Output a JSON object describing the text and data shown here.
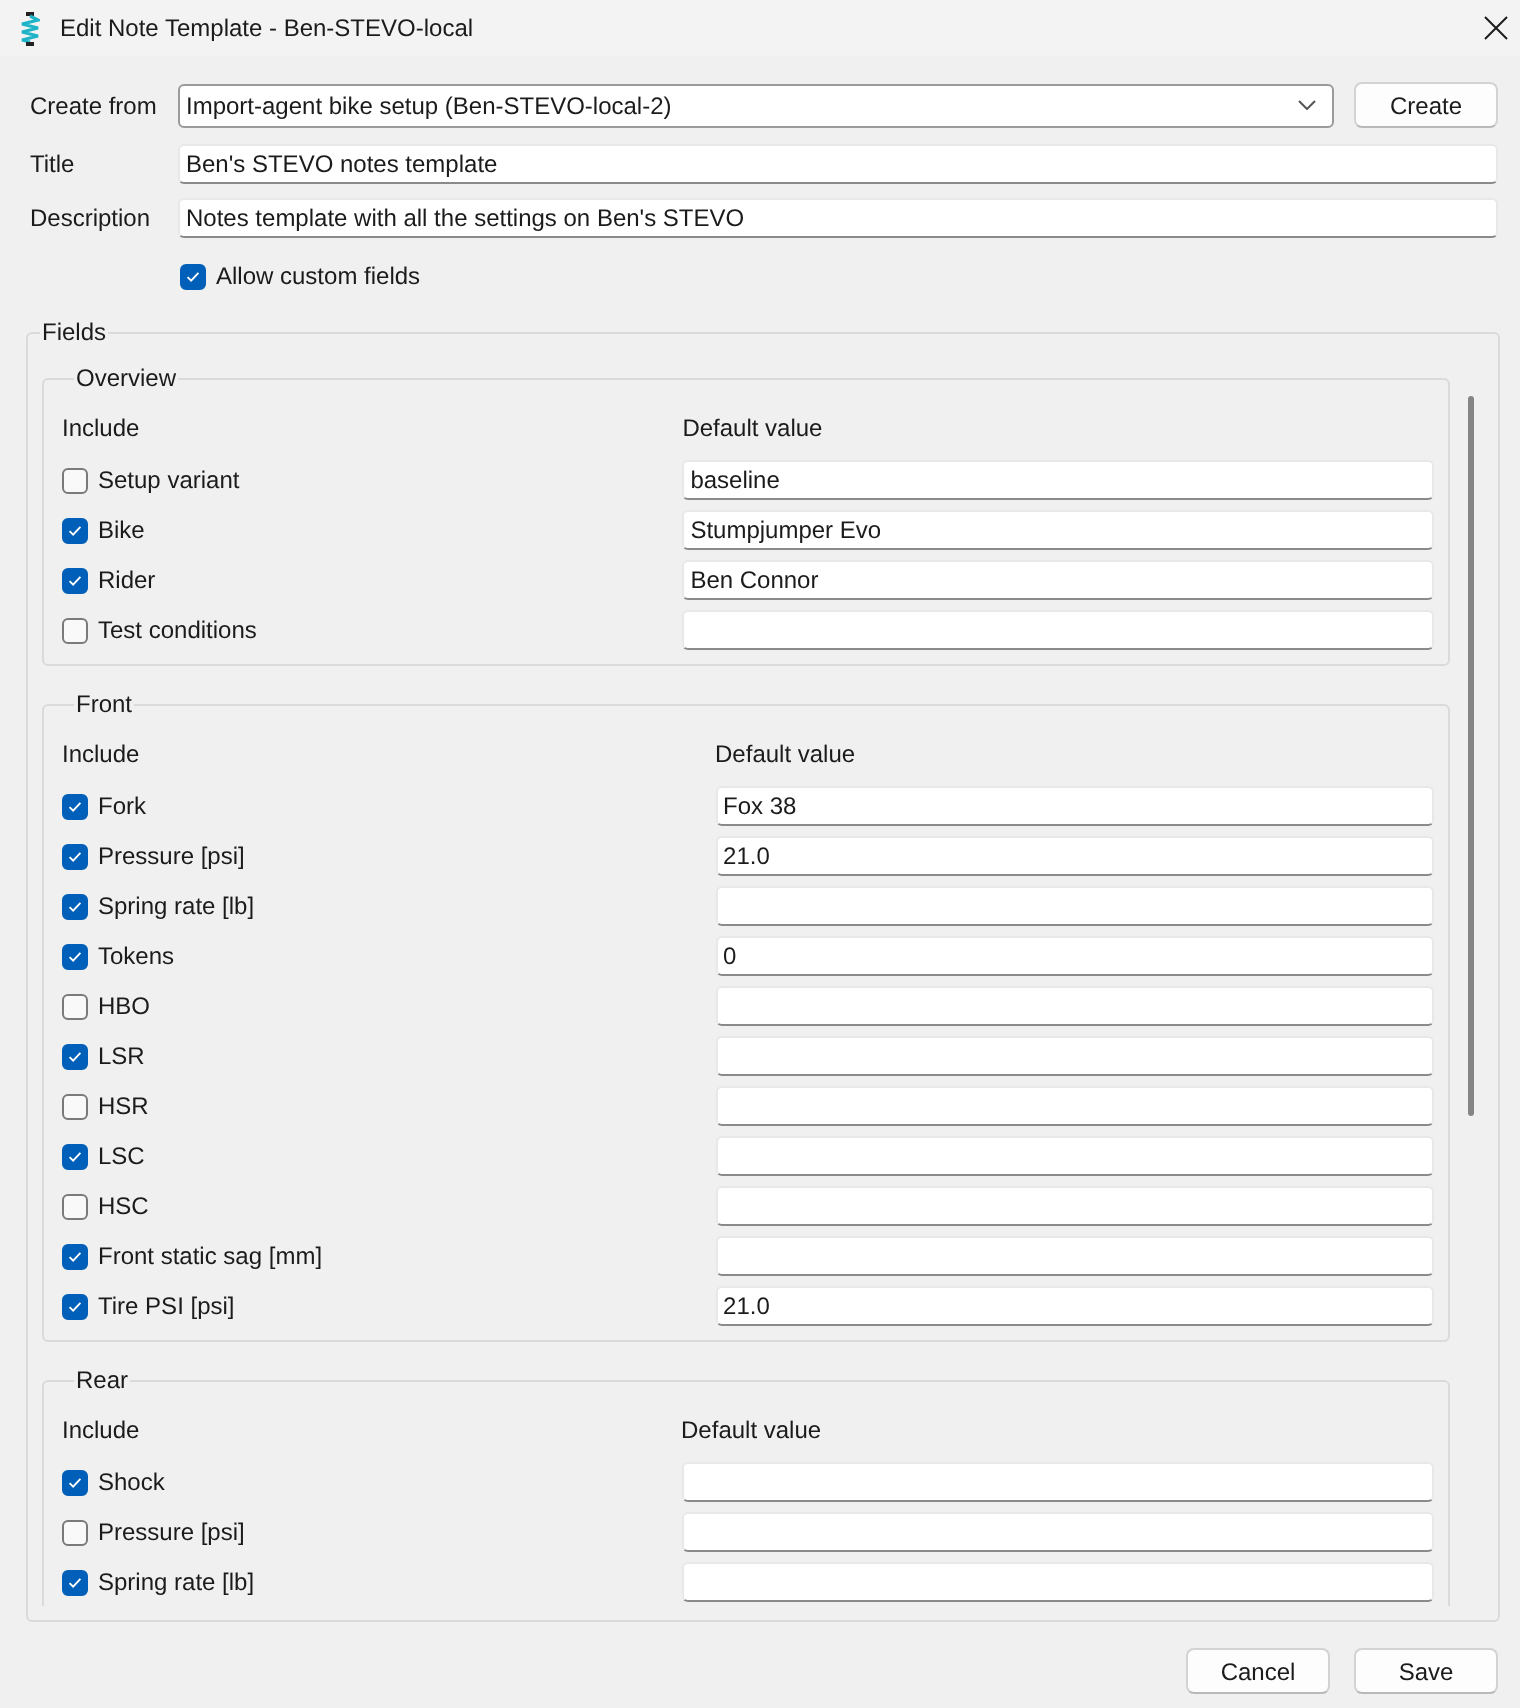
{
  "window": {
    "title": "Edit Note Template - Ben-STEVO-local"
  },
  "form": {
    "create_from": {
      "label": "Create from",
      "value": "Import-agent bike setup (Ben-STEVO-local-2)",
      "button": "Create"
    },
    "title": {
      "label": "Title",
      "value": "Ben's STEVO notes template"
    },
    "description": {
      "label": "Description",
      "value": "Notes template with all the settings on Ben's STEVO"
    },
    "allow_custom_fields": {
      "label": "Allow custom fields",
      "checked": true
    }
  },
  "fields": {
    "title": "Fields",
    "sections": [
      {
        "title": "Overview",
        "columns": [
          "Include",
          "Default value"
        ],
        "rows": [
          {
            "label": "Setup variant",
            "checked": false,
            "value": "baseline"
          },
          {
            "label": "Bike",
            "checked": true,
            "value": "Stumpjumper Evo"
          },
          {
            "label": "Rider",
            "checked": true,
            "value": "Ben Connor"
          },
          {
            "label": "Test conditions",
            "checked": false
          }
        ]
      },
      {
        "title": "Front",
        "columns": [
          "Include",
          "Default value"
        ],
        "rows": [
          {
            "label": "Fork",
            "checked": true,
            "value": "Fox 38"
          },
          {
            "label": "Pressure [psi]",
            "checked": true,
            "value": "21.0"
          },
          {
            "label": "Spring rate [lb]",
            "checked": true
          },
          {
            "label": "Tokens",
            "checked": true,
            "value": "0"
          },
          {
            "label": "HBO",
            "checked": false
          },
          {
            "label": "LSR",
            "checked": true
          },
          {
            "label": "HSR",
            "checked": false
          },
          {
            "label": "LSC",
            "checked": true
          },
          {
            "label": "HSC",
            "checked": false
          },
          {
            "label": "Front static sag [mm]",
            "checked": true
          },
          {
            "label": "Tire PSI [psi]",
            "checked": true,
            "value": "21.0"
          }
        ]
      },
      {
        "title": "Rear",
        "columns": [
          "Include",
          "Default value"
        ],
        "rows": [
          {
            "label": "Shock",
            "checked": true
          },
          {
            "label": "Pressure [psi]",
            "checked": false
          },
          {
            "label": "Spring rate [lb]",
            "checked": true
          }
        ]
      }
    ]
  },
  "buttons": [
    {
      "label": "Cancel"
    },
    {
      "label": "Save"
    }
  ]
}
